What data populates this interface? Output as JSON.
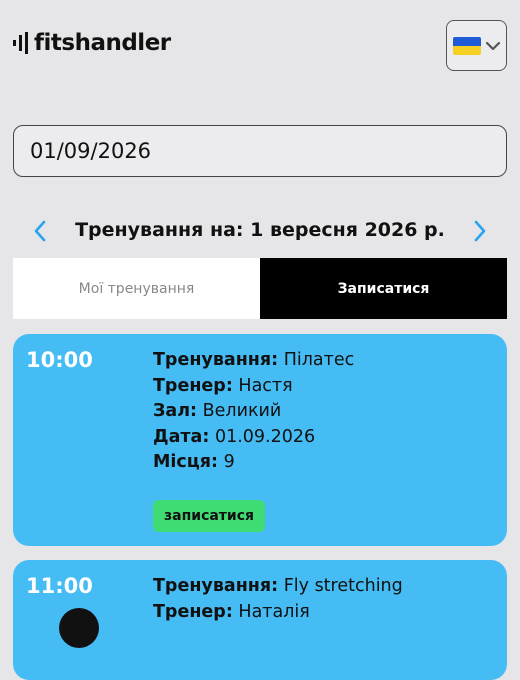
{
  "header": {
    "logo_text": "fitshandler",
    "language": {
      "flag": "ukraine-flag",
      "colors": [
        "#1f5bd6",
        "#f6cf23"
      ]
    }
  },
  "date_picker": {
    "value": "01/09/2026"
  },
  "date_nav": {
    "title": "Тренування на: 1 вересня 2026 р.",
    "accent": "#2aa3f0"
  },
  "tabs": [
    {
      "label": "Мої тренування",
      "active": false
    },
    {
      "label": "Записатися",
      "active": true
    }
  ],
  "labels": {
    "training": "Тренування:",
    "trainer": "Тренер:",
    "hall": "Зал:",
    "date": "Дата:",
    "places": "Місця:"
  },
  "sessions": [
    {
      "time": "10:00",
      "training": "Пілатес",
      "trainer": "Настя",
      "hall": "Великий",
      "date": "01.09.2026",
      "places": "9",
      "button": "записатися"
    },
    {
      "time": "11:00",
      "training": "Fly stretching",
      "trainer": "Наталія"
    }
  ],
  "colors": {
    "card": "#45bcf4",
    "signup_button": "#3fdc74",
    "active_tab": "#000000"
  }
}
